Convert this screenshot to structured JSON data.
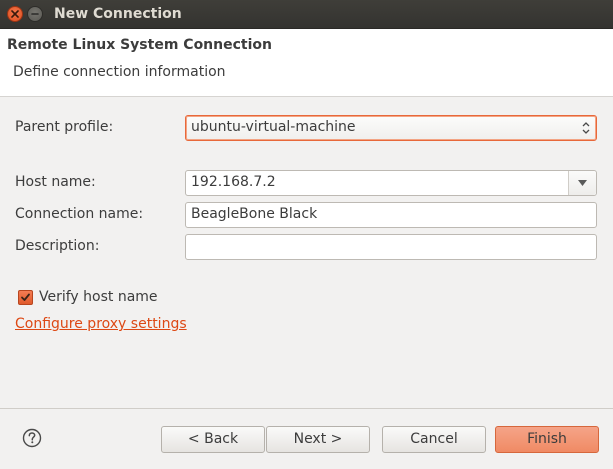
{
  "window": {
    "title": "New Connection"
  },
  "header": {
    "title": "Remote Linux System Connection",
    "description": "Define connection information"
  },
  "form": {
    "parent_profile": {
      "label": "Parent profile:",
      "value": "ubuntu-virtual-machine"
    },
    "host_name": {
      "label": "Host name:",
      "value": "192.168.7.2"
    },
    "connection_name": {
      "label": "Connection name:",
      "value": "BeagleBone Black"
    },
    "description": {
      "label": "Description:",
      "value": ""
    },
    "verify_host": {
      "label": "Verify host name",
      "checked": true
    },
    "proxy_link": "Configure proxy settings"
  },
  "buttons": {
    "back": "< Back",
    "next": "Next >",
    "cancel": "Cancel",
    "finish": "Finish"
  },
  "colors": {
    "accent": "#dd4814",
    "finish_bg": "#f08a64",
    "titlebar": "#3c3b37"
  },
  "icons": {
    "close": "close-icon",
    "minimize": "minimize-icon",
    "help": "help-icon",
    "select_arrows": "updown-arrows-icon",
    "combo_arrow": "chevron-down-icon",
    "checkmark": "checkmark-icon"
  }
}
